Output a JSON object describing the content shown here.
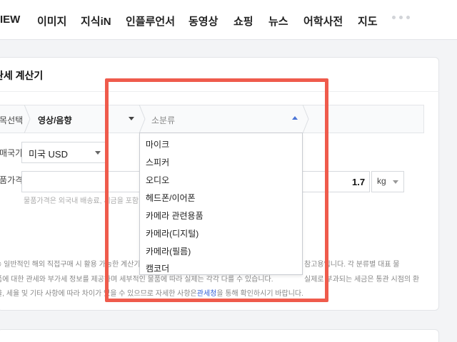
{
  "nav": {
    "items": [
      "IEW",
      "이미지",
      "지식iN",
      "인플루언서",
      "동영상",
      "쇼핑",
      "뉴스",
      "어학사전",
      "지도"
    ]
  },
  "card": {
    "title": "관세 계산기"
  },
  "crumbs": {
    "first": "품목선택",
    "second": "영상/음향",
    "third_placeholder": "소분류"
  },
  "form": {
    "country_label": "구매국가",
    "country_value": "미국 USD",
    "price_label": "물품가격",
    "weight_value": "1.7",
    "weight_unit": "kg",
    "hint": "물품가격은 외국내 배송료, 세금을 포함"
  },
  "notice": {
    "line1_a": "※ 일반적인 해외 직접구매 시 활용 가능한 계산기",
    "line1_b": "참고용입니다. 각 분류별 대표 물",
    "line2_a": "품에 대한 관세와 부가세 정보를 제공하며 세부적인 물품에 따라 실제는 각각 다를 수 있습니다.",
    "line2_b": "실제로 부과되는 세금은 통관 시점의 환",
    "line3_a": "율, 세율 및 기타 사항에 따라 차이가 있을 수 있으므로 자세한 사항은",
    "line3_link": "관세청",
    "line3_b": "을 통해 확인하시기 바랍니다."
  },
  "dropdown": {
    "items": [
      "마이크",
      "스피커",
      "오디오",
      "헤드폰/이어폰",
      "카메라 관련용품",
      "카메라(디지털)",
      "카메라(필름)",
      "캠코더"
    ]
  },
  "colors": {
    "highlight": "#ef5b4c",
    "link": "#2d5bd7",
    "caret_up": "#4b74d6"
  }
}
